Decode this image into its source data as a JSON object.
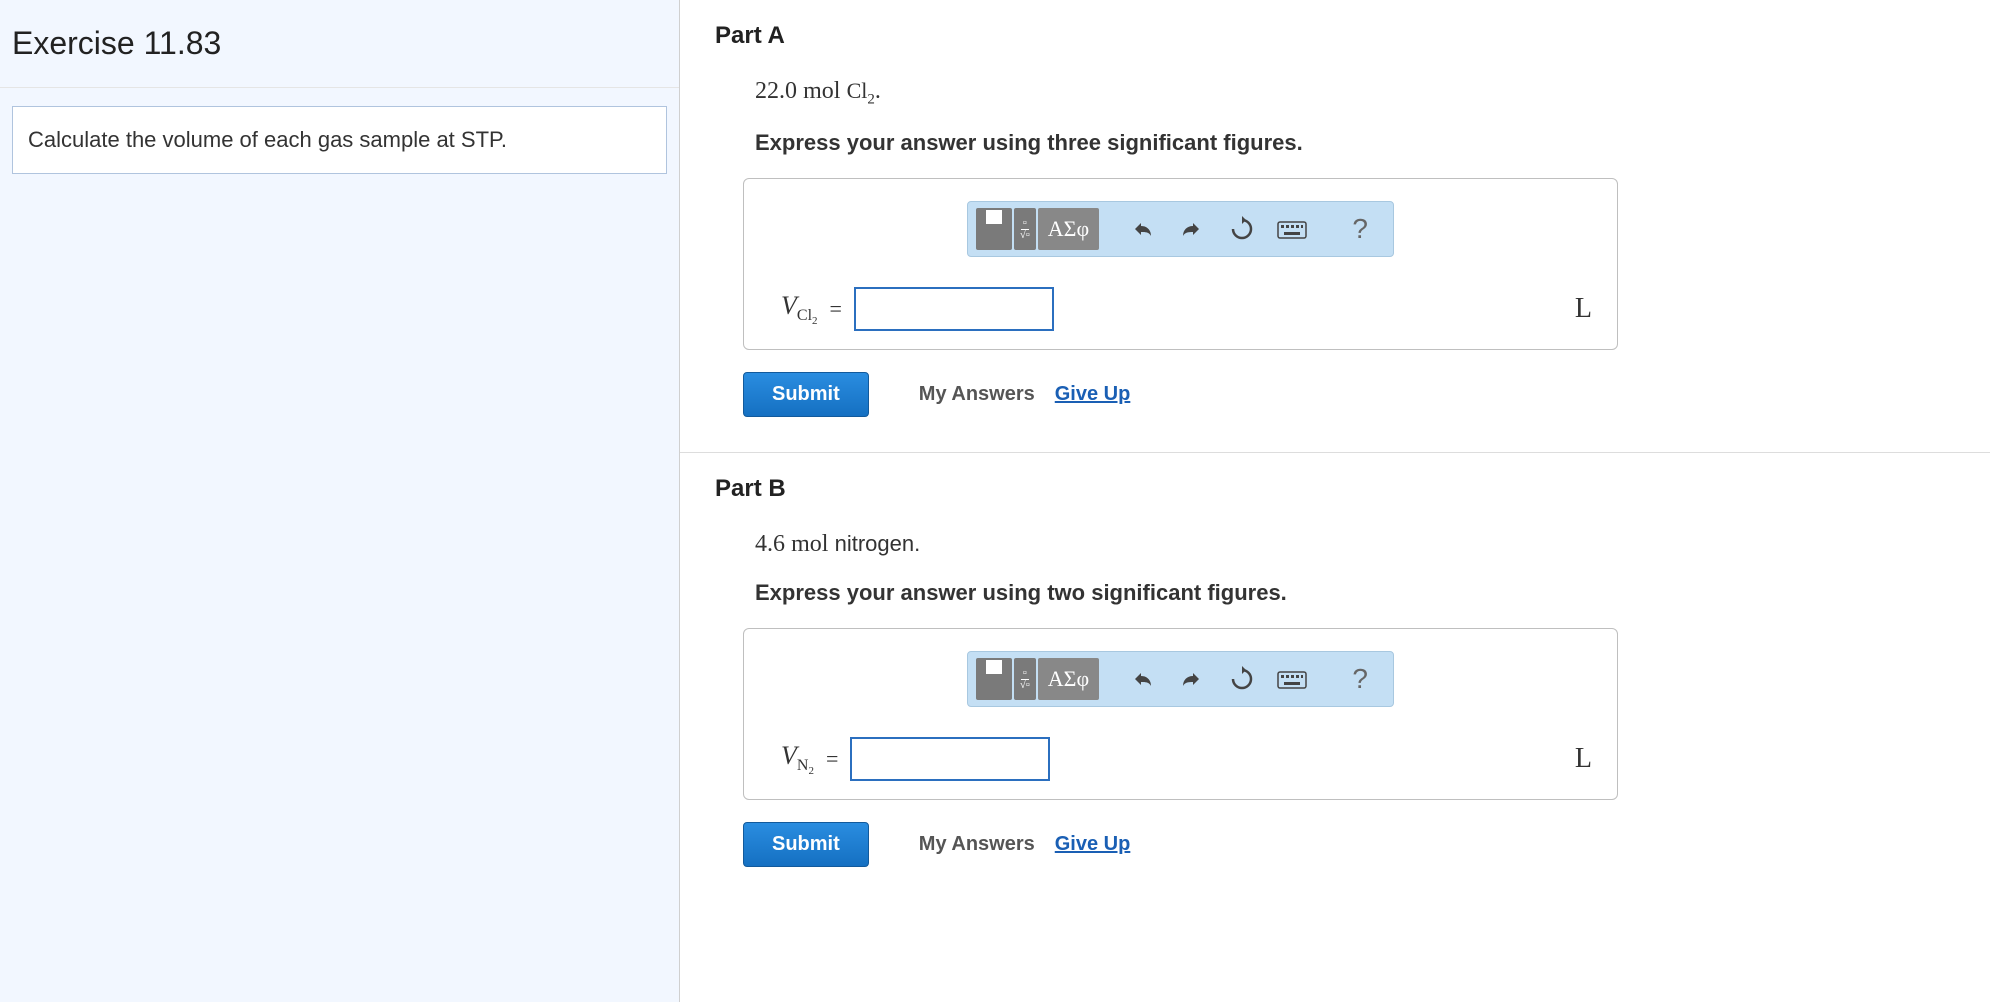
{
  "left": {
    "title": "Exercise 11.83",
    "problem": "Calculate the volume of each gas sample at STP."
  },
  "partA": {
    "title": "Part A",
    "amount": "22.0",
    "unit_text": "mol",
    "species_base": "Cl",
    "species_sub": "2",
    "species_suffix": ".",
    "instruction": "Express your answer using three significant figures.",
    "var_letter": "V",
    "var_sub_base": "Cl",
    "var_sub_sub": "2",
    "equals": "=",
    "unit": "L",
    "submit": "Submit",
    "myAnswers": "My Answers",
    "giveUp": "Give Up",
    "greek": "ΑΣφ",
    "help": "?"
  },
  "partB": {
    "title": "Part B",
    "amount": "4.6",
    "unit_text": "mol",
    "species_text": "nitrogen.",
    "instruction": "Express your answer using two significant figures.",
    "var_letter": "V",
    "var_sub_base": "N",
    "var_sub_sub": "2",
    "equals": "=",
    "unit": "L",
    "submit": "Submit",
    "myAnswers": "My Answers",
    "giveUp": "Give Up",
    "greek": "ΑΣφ",
    "help": "?"
  }
}
